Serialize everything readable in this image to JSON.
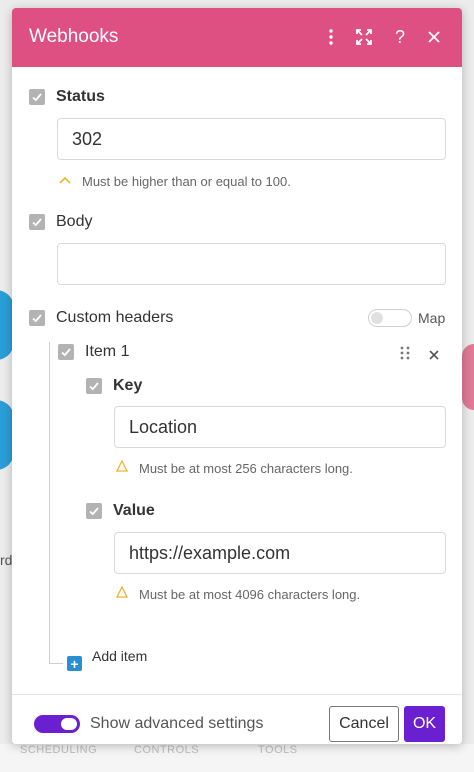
{
  "dialog": {
    "title": "Webhooks",
    "header_icons": [
      "more-vertical-icon",
      "expand-icon",
      "help-icon",
      "close-icon"
    ]
  },
  "fields": {
    "status": {
      "label": "Status",
      "value": "302",
      "hint": "Must be higher than or equal to 100."
    },
    "body": {
      "label": "Body",
      "value": ""
    },
    "custom_headers": {
      "label": "Custom headers",
      "map_label": "Map",
      "item": {
        "label": "Item 1",
        "key": {
          "label": "Key",
          "value": "Location",
          "hint": "Must be at most 256 characters long."
        },
        "value": {
          "label": "Value",
          "value": "https://example.com",
          "hint": "Must be at most 4096 characters long."
        }
      },
      "add_item_label": "Add item"
    }
  },
  "footer": {
    "advanced_label": "Show advanced settings",
    "advanced_enabled": true,
    "cancel_label": "Cancel",
    "ok_label": "OK"
  },
  "background": {
    "left_text": "rd",
    "bottom_tabs": [
      "SCHEDULING",
      "CONTROLS",
      "TOOLS"
    ]
  },
  "colors": {
    "header": "#de4f82",
    "accent": "#6a1fd0",
    "add": "#2a8fd0",
    "warning": "#f0b429"
  }
}
